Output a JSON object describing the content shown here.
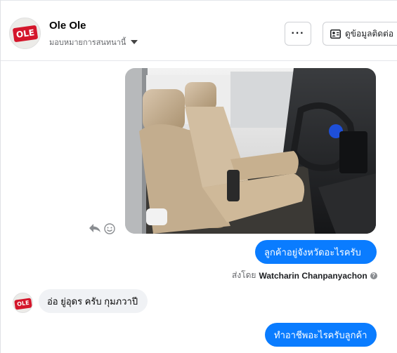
{
  "header": {
    "page_name": "Ole Ole",
    "assign_label": "มอบหมายการสนทนานี้",
    "more_label": "···",
    "contact_label": "ดูข้อมูลติดต่อ",
    "avatar_text": "OLE"
  },
  "conversation": {
    "messages": [
      {
        "direction": "outgoing",
        "type": "image",
        "description_icon": "car-interior-photo"
      },
      {
        "direction": "outgoing",
        "type": "text",
        "text": "ลูกค้าอยู่จังหวัดอะไรครับ"
      },
      {
        "direction": "incoming",
        "type": "text",
        "text": "อ่อ ยู่อุดร ครับ กุมภวาปี"
      },
      {
        "direction": "outgoing",
        "type": "text",
        "text": "ทำอาชีพอะไรครับลูกค้า"
      }
    ],
    "sent_by_prefix": "ส่งโดย",
    "sent_by_name": "Watcharin Chanpanyachon",
    "help_glyph": "?"
  },
  "colors": {
    "outgoing_bubble": "#0a7cff",
    "incoming_bubble": "#f0f2f5",
    "brand_red": "#d4162b"
  }
}
